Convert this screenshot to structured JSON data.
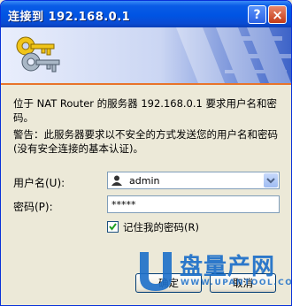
{
  "window": {
    "title": "连接到 192.168.0.1",
    "help_label": "?",
    "close_label": "×"
  },
  "dialog": {
    "message": "位于 NAT Router 的服务器 192.168.0.1 要求用户名和密码。",
    "warning": "警告：此服务器要求以不安全的方式发送您的用户名和密码(没有安全连接的基本认证)。"
  },
  "form": {
    "username_label": "用户名(U):",
    "username_value": "admin",
    "password_label": "密码(P):",
    "password_value": "*****",
    "remember_label": "记住我的密码(R)",
    "remember_checked": true
  },
  "buttons": {
    "ok_label": "确定",
    "cancel_label": "取消"
  },
  "watermark": {
    "text": "盘量产网",
    "url": "WWW.UPANTOOL.COM"
  },
  "colors": {
    "titlebar": "#0054e3",
    "accent_line": "#e8742a",
    "watermark": "#1c6fc9"
  }
}
